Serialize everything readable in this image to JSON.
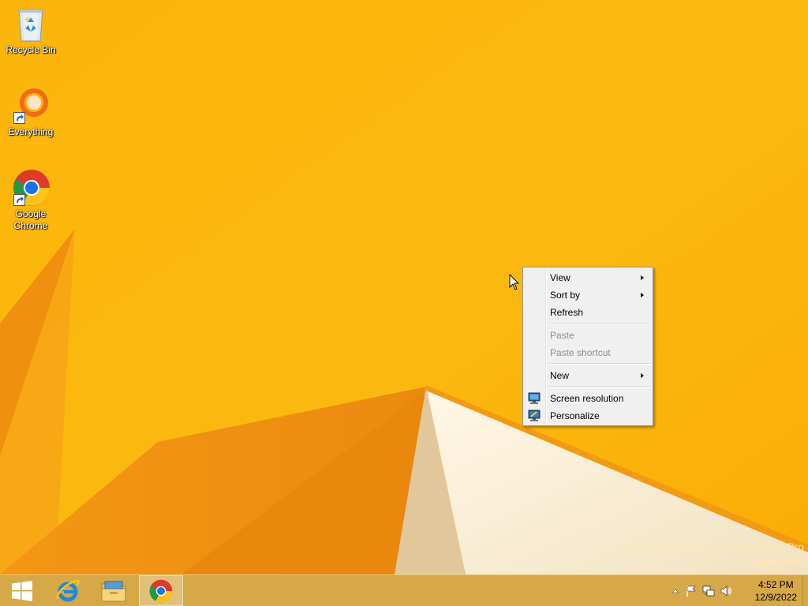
{
  "desktop": {
    "background_color": "#fbb80c",
    "icons": [
      {
        "label": "Recycle Bin",
        "icon": "recycle-bin-icon"
      },
      {
        "label": "Everything",
        "icon": "everything-icon"
      },
      {
        "label": "Google\nChrome",
        "icon": "chrome-icon"
      }
    ],
    "watermark": {
      "line1": "Windows Embedded 8.1 Industry Pro",
      "line2": "Build 9600"
    }
  },
  "context_menu": {
    "items": [
      {
        "label": "View",
        "submenu": true,
        "enabled": true
      },
      {
        "label": "Sort by",
        "submenu": true,
        "enabled": true
      },
      {
        "label": "Refresh",
        "submenu": false,
        "enabled": true
      },
      {
        "label": "Paste",
        "submenu": false,
        "enabled": false
      },
      {
        "label": "Paste shortcut",
        "submenu": false,
        "enabled": false
      },
      {
        "label": "New",
        "submenu": true,
        "enabled": true
      },
      {
        "label": "Screen resolution",
        "submenu": false,
        "enabled": true,
        "icon": "monitor-icon"
      },
      {
        "label": "Personalize",
        "submenu": false,
        "enabled": true,
        "icon": "personalize-icon"
      }
    ]
  },
  "taskbar": {
    "color": "#d6a847",
    "buttons": [
      {
        "name": "start",
        "icon": "windows-logo-icon"
      },
      {
        "name": "internet-explorer",
        "icon": "ie-icon"
      },
      {
        "name": "file-explorer",
        "icon": "folder-icon"
      },
      {
        "name": "google-chrome",
        "icon": "chrome-icon",
        "active": true
      }
    ],
    "tray": {
      "icons": [
        "show-hidden-icons-icon",
        "action-center-flag-icon",
        "network-icon",
        "volume-icon"
      ],
      "time": "4:52 PM",
      "date": "12/9/2022"
    }
  }
}
